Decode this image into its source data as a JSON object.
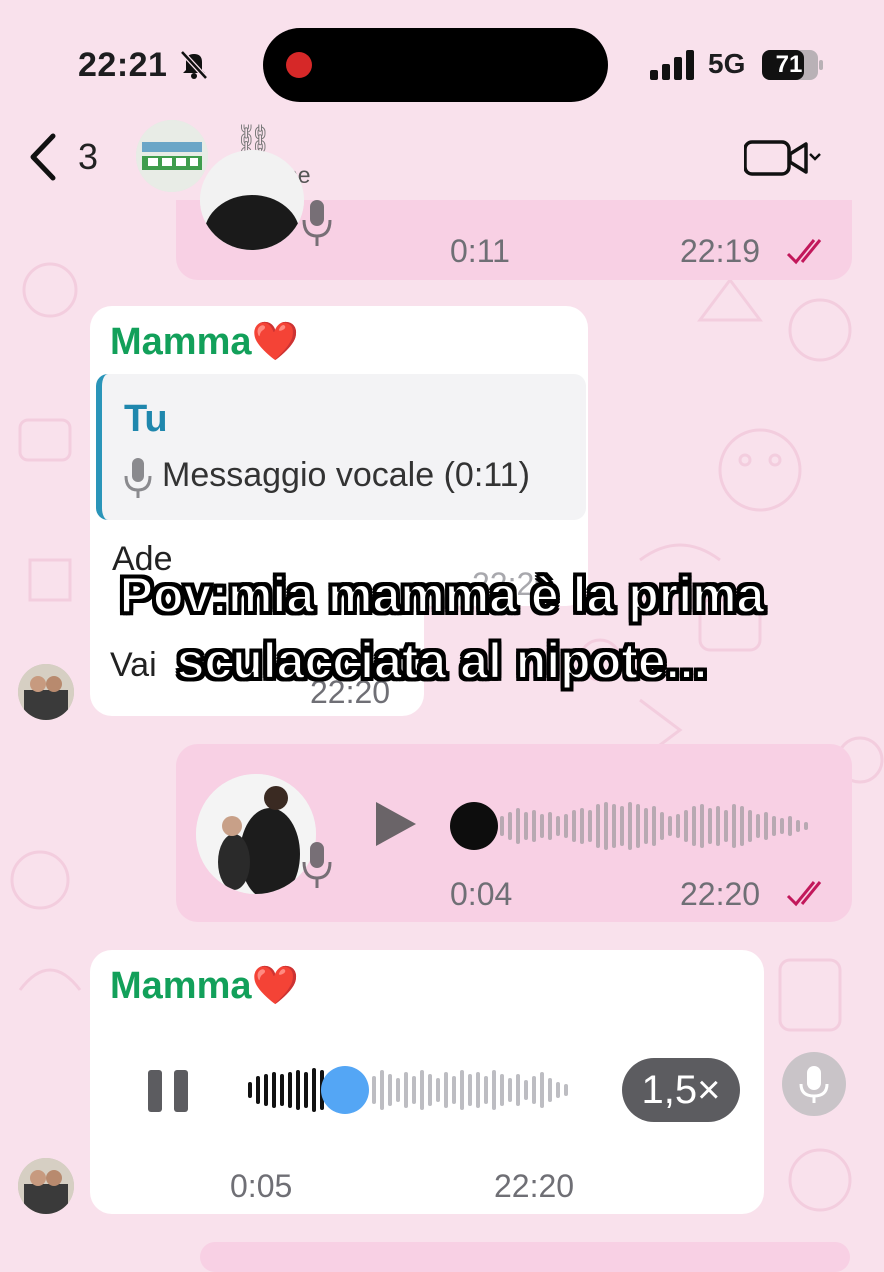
{
  "status_bar": {
    "time": "22:21",
    "network": "5G",
    "battery": "71"
  },
  "header": {
    "back_count": "3",
    "group_name_icon": "⛓",
    "online": "3 online"
  },
  "messages": {
    "top_voice": {
      "duration": "0:11",
      "time": "22:19"
    },
    "reply_msg": {
      "sender": "Mamma❤️",
      "quote_author": "Tu",
      "quote_text": "Messaggio vocale (0:11)",
      "line1": "Ade",
      "line2": "Vai",
      "time_partial": "22:20",
      "time": "22:20"
    },
    "out_voice": {
      "duration": "0:04",
      "time": "22:20"
    },
    "in_voice": {
      "sender": "Mamma❤️",
      "elapsed": "0:05",
      "time": "22:20",
      "speed": "1,5×"
    }
  },
  "overlay": {
    "line1": "Pov:mia mamma è la prima",
    "line2": "sculacciata al nipote..."
  },
  "colors": {
    "accent_green": "#12a05a",
    "quote_blue": "#1f87ad",
    "out_bubble": "#f8d0e4",
    "tick": "#c2185b"
  }
}
